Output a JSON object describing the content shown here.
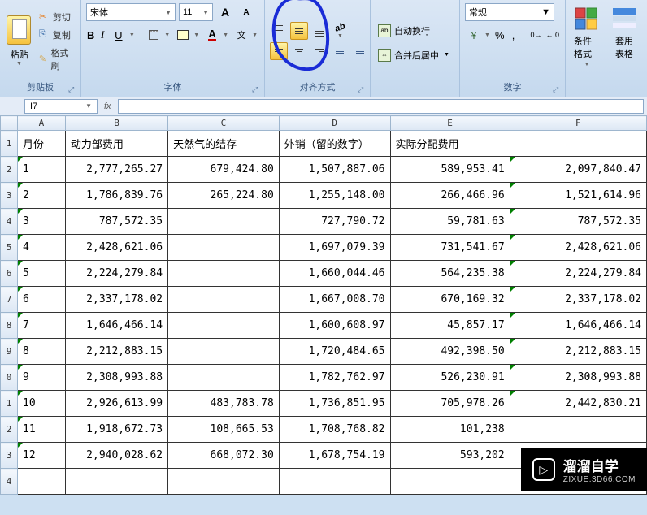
{
  "ribbon": {
    "clipboard": {
      "label": "剪贴板",
      "paste": "粘贴",
      "cut": "剪切",
      "copy": "复制",
      "format_painter": "格式刷"
    },
    "font": {
      "label": "字体",
      "font_name": "宋体",
      "font_size": "11"
    },
    "alignment": {
      "label": "对齐方式",
      "wrap_text": "自动换行",
      "merge_center": "合并后居中"
    },
    "number": {
      "label": "数字",
      "format": "常规"
    },
    "styles": {
      "cond_format": "条件格式",
      "table_format": "套用\n表格"
    }
  },
  "cell_ref": "I7",
  "fx": "fx",
  "columns": [
    "A",
    "B",
    "C",
    "D",
    "E",
    "F"
  ],
  "headers": {
    "A": "月份",
    "B": "动力部费用",
    "C": "天然气的结存",
    "D": "外销（留的数字）",
    "E": "实际分配费用",
    "F": ""
  },
  "rows": [
    {
      "n": "1",
      "A": "1",
      "B": "2,777,265.27",
      "C": "679,424.80",
      "D": "1,507,887.06",
      "E": "589,953.41",
      "F": "2,097,840.47"
    },
    {
      "n": "2",
      "A": "2",
      "B": "1,786,839.76",
      "C": "265,224.80",
      "D": "1,255,148.00",
      "E": "266,466.96",
      "F": "1,521,614.96"
    },
    {
      "n": "3",
      "A": "3",
      "B": "787,572.35",
      "C": "",
      "D": "727,790.72",
      "E": "59,781.63",
      "F": "787,572.35"
    },
    {
      "n": "4",
      "A": "4",
      "B": "2,428,621.06",
      "C": "",
      "D": "1,697,079.39",
      "E": "731,541.67",
      "F": "2,428,621.06"
    },
    {
      "n": "5",
      "A": "5",
      "B": "2,224,279.84",
      "C": "",
      "D": "1,660,044.46",
      "E": "564,235.38",
      "F": "2,224,279.84"
    },
    {
      "n": "6",
      "A": "6",
      "B": "2,337,178.02",
      "C": "",
      "D": "1,667,008.70",
      "E": "670,169.32",
      "F": "2,337,178.02"
    },
    {
      "n": "7",
      "A": "7",
      "B": "1,646,466.14",
      "C": "",
      "D": "1,600,608.97",
      "E": "45,857.17",
      "F": "1,646,466.14"
    },
    {
      "n": "8",
      "A": "8",
      "B": "2,212,883.15",
      "C": "",
      "D": "1,720,484.65",
      "E": "492,398.50",
      "F": "2,212,883.15"
    },
    {
      "n": "9",
      "A": "9",
      "B": "2,308,993.88",
      "C": "",
      "D": "1,782,762.97",
      "E": "526,230.91",
      "F": "2,308,993.88"
    },
    {
      "n": "10",
      "A": "10",
      "B": "2,926,613.99",
      "C": "483,783.78",
      "D": "1,736,851.95",
      "E": "705,978.26",
      "F": "2,442,830.21"
    },
    {
      "n": "11",
      "A": "11",
      "B": "1,918,672.73",
      "C": "108,665.53",
      "D": "1,708,768.82",
      "E": "101,238",
      "F": ""
    },
    {
      "n": "12",
      "A": "12",
      "B": "2,940,028.62",
      "C": "668,072.30",
      "D": "1,678,754.19",
      "E": "593,202",
      "F": ""
    }
  ],
  "row_nums": [
    "1",
    "2",
    "3",
    "4",
    "5",
    "6",
    "7",
    "8",
    "9",
    "0",
    "1",
    "2",
    "3",
    "4"
  ],
  "watermark": {
    "title": "溜溜自学",
    "url": "ZIXUE.3D66.COM"
  }
}
